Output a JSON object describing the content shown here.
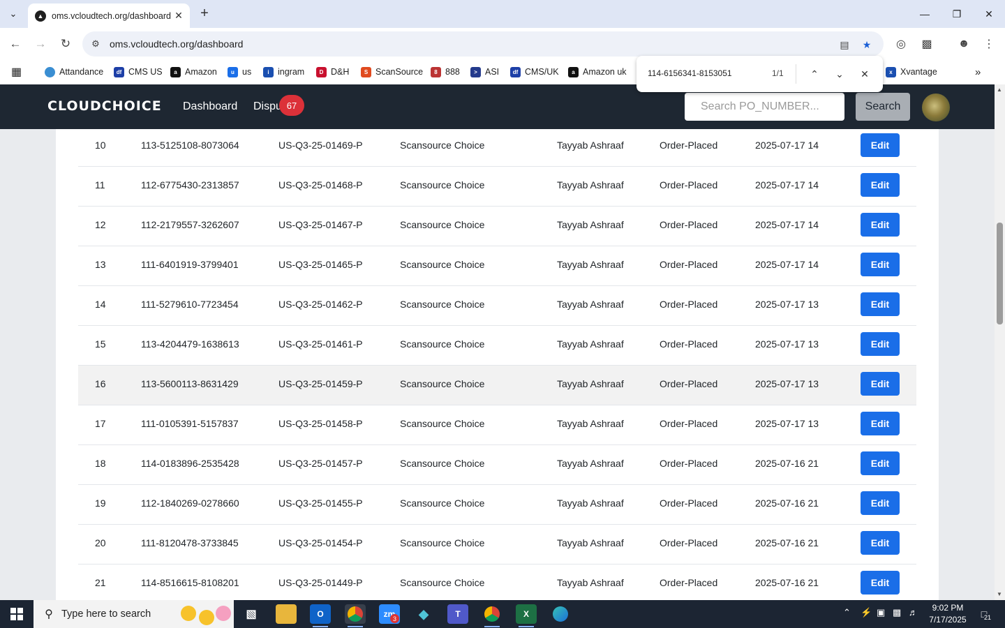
{
  "browser": {
    "tab_title": "oms.vcloudtech.org/dashboard",
    "url": "oms.vcloudtech.org/dashboard",
    "bookmarks": [
      "Attandance",
      "CMS US",
      "Amazon",
      "us",
      "ingram",
      "D&H",
      "ScanSource",
      "888",
      "ASI",
      "CMS/UK",
      "Amazon uk",
      "Xvantage"
    ],
    "find": {
      "query": "114-6156341-8153051",
      "count": "1/1"
    }
  },
  "app": {
    "logo": "CLOUDCHOICE",
    "nav": {
      "dashboard": "Dashboard",
      "disputes": "Dispu",
      "disputes_badge": "67"
    },
    "search": {
      "placeholder": "Search PO_NUMBER...",
      "button": "Search"
    }
  },
  "table": {
    "rows": [
      [
        "10",
        "113-5125108-8073064",
        "US-Q3-25-01469-P",
        "Scansource Choice",
        "Tayyab Ashraaf",
        "Order-Placed",
        "2025-07-17 14",
        "Edit"
      ],
      [
        "11",
        "112-6775430-2313857",
        "US-Q3-25-01468-P",
        "Scansource Choice",
        "Tayyab Ashraaf",
        "Order-Placed",
        "2025-07-17 14",
        "Edit"
      ],
      [
        "12",
        "112-2179557-3262607",
        "US-Q3-25-01467-P",
        "Scansource Choice",
        "Tayyab Ashraaf",
        "Order-Placed",
        "2025-07-17 14",
        "Edit"
      ],
      [
        "13",
        "111-6401919-3799401",
        "US-Q3-25-01465-P",
        "Scansource Choice",
        "Tayyab Ashraaf",
        "Order-Placed",
        "2025-07-17 14",
        "Edit"
      ],
      [
        "14",
        "111-5279610-7723454",
        "US-Q3-25-01462-P",
        "Scansource Choice",
        "Tayyab Ashraaf",
        "Order-Placed",
        "2025-07-17 13",
        "Edit"
      ],
      [
        "15",
        "113-4204479-1638613",
        "US-Q3-25-01461-P",
        "Scansource Choice",
        "Tayyab Ashraaf",
        "Order-Placed",
        "2025-07-17 13",
        "Edit"
      ],
      [
        "16",
        "113-5600113-8631429",
        "US-Q3-25-01459-P",
        "Scansource Choice",
        "Tayyab Ashraaf",
        "Order-Placed",
        "2025-07-17 13",
        "Edit"
      ],
      [
        "17",
        "111-0105391-5157837",
        "US-Q3-25-01458-P",
        "Scansource Choice",
        "Tayyab Ashraaf",
        "Order-Placed",
        "2025-07-17 13",
        "Edit"
      ],
      [
        "18",
        "114-0183896-2535428",
        "US-Q3-25-01457-P",
        "Scansource Choice",
        "Tayyab Ashraaf",
        "Order-Placed",
        "2025-07-16 21",
        "Edit"
      ],
      [
        "19",
        "112-1840269-0278660",
        "US-Q3-25-01455-P",
        "Scansource Choice",
        "Tayyab Ashraaf",
        "Order-Placed",
        "2025-07-16 21",
        "Edit"
      ],
      [
        "20",
        "111-8120478-3733845",
        "US-Q3-25-01454-P",
        "Scansource Choice",
        "Tayyab Ashraaf",
        "Order-Placed",
        "2025-07-16 21",
        "Edit"
      ],
      [
        "21",
        "114-8516615-8108201",
        "US-Q3-25-01449-P",
        "Scansource Choice",
        "Tayyab Ashraaf",
        "Order-Placed",
        "2025-07-16 21",
        "Edit"
      ]
    ],
    "highlighted_row": "16"
  },
  "taskbar": {
    "search_placeholder": "Type here to search",
    "time": "9:02 PM",
    "date": "7/17/2025",
    "notifications": "21",
    "zoom_badge": "3"
  },
  "colors": {
    "header_bg": "#1e2732",
    "edit_button": "#1a6ee8",
    "badge": "#dc3139"
  }
}
